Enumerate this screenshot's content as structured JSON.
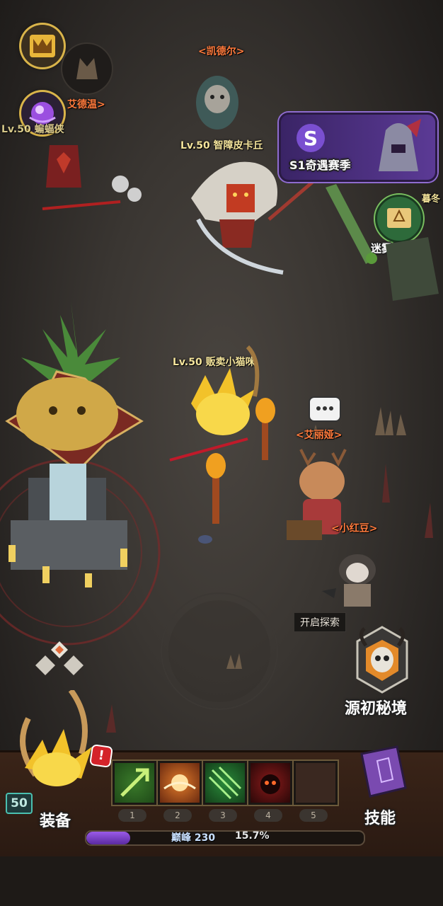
{
  "top_left": {
    "badge_icon": "m-crest-icon",
    "orb_icon": "purple-orb-icon",
    "hero_icon": "wolf-avatar-icon"
  },
  "npcs": {
    "kaideer": "<凯德尔>",
    "adewen": "艾德温>",
    "bat_hero": "Lv.50 蝙蝠侠",
    "pika": "Lv.50 智障皮卡丘",
    "player": "Lv.50 贩卖小猫咪",
    "aliya": "<艾丽娅>",
    "xiaohongdou": "<小红豆>",
    "muyu": "暮冬"
  },
  "season_banner": {
    "label": "S1奇遇赛季",
    "icon": "season-s-icon"
  },
  "fog_manual": {
    "label": "迷雾手册",
    "icon": "book-badge-icon"
  },
  "origin_realm": {
    "tooltip": "开启探索",
    "label": "源初秘境",
    "icon": "skull-shrine-icon"
  },
  "bottom_bar": {
    "equip_label": "装备",
    "skill_label": "技能",
    "level": "50",
    "alert": "!",
    "skill_slots": [
      "1",
      "2",
      "3",
      "4",
      "5"
    ],
    "exp_text": "巅峰 230",
    "exp_percent": "15.7%",
    "exp_fraction": 0.157
  },
  "colors": {
    "name_orange": "#ff7a3c",
    "name_yellow": "#f3e39b",
    "exp_purple": "#7b3fd0",
    "season_purple": "#4b2b80"
  }
}
